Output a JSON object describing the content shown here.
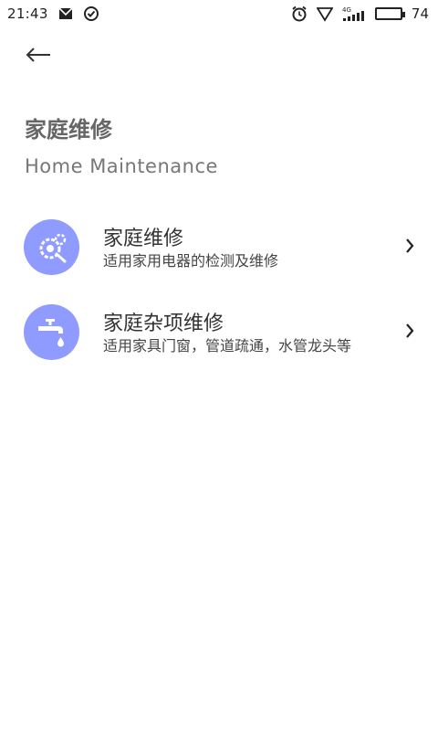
{
  "status_bar": {
    "time": "21:43",
    "battery": "74",
    "network": "4G",
    "battery_level": 0.74,
    "icons": [
      "mail-icon",
      "check-circle-icon",
      "alarm-icon",
      "wifi-icon",
      "signal-icon",
      "battery-icon"
    ]
  },
  "header": {
    "back_icon": "arrow-left-icon",
    "title": "家庭维修",
    "subtitle": "Home Maintenance"
  },
  "services": [
    {
      "icon": "gear-repair-icon",
      "name": "家庭维修",
      "description": "适用家用电器的检测及维修"
    },
    {
      "icon": "faucet-icon",
      "name": "家庭杂项维修",
      "description": "适用家具门窗，管道疏通，水管龙头等"
    }
  ],
  "colors": {
    "accent": "#8f9bff",
    "title": "#666666",
    "subtitle": "#777777"
  }
}
